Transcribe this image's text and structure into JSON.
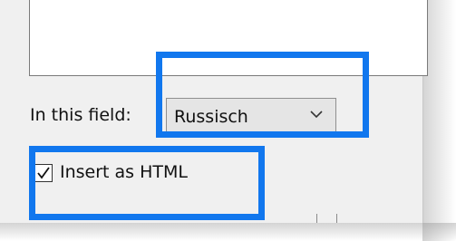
{
  "field": {
    "label": "In this field:",
    "selected_value": "Russisch"
  },
  "checkbox": {
    "label": "Insert as HTML",
    "checked": true
  },
  "colors": {
    "highlight": "#1177ee",
    "dialog_bg": "#f0f0f0"
  },
  "icons": {
    "dropdown": "chevron-down-icon",
    "check": "checkmark-icon"
  }
}
